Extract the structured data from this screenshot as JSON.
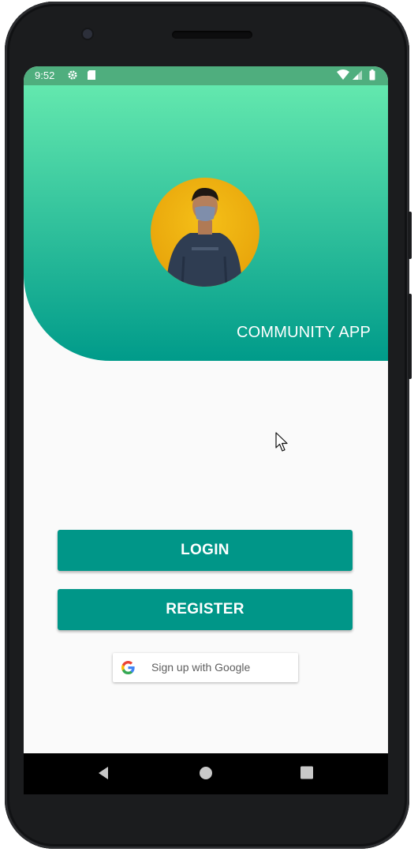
{
  "status_bar": {
    "time": "9:52",
    "icons": [
      "gear-icon",
      "sd-card-icon",
      "wifi-icon",
      "signal-icon",
      "battery-icon"
    ]
  },
  "header": {
    "app_title": "COMMUNITY APP"
  },
  "actions": {
    "login_label": "LOGIN",
    "register_label": "REGISTER",
    "google_label": "Sign up with Google"
  },
  "nav_bar": {
    "icons": [
      "back-icon",
      "home-icon",
      "recents-icon"
    ]
  },
  "colors": {
    "status_bar": "#4fae7e",
    "header_top": "#63e8ae",
    "header_bottom": "#009b8a",
    "button": "#009688",
    "screen_bg": "#fafafa"
  }
}
